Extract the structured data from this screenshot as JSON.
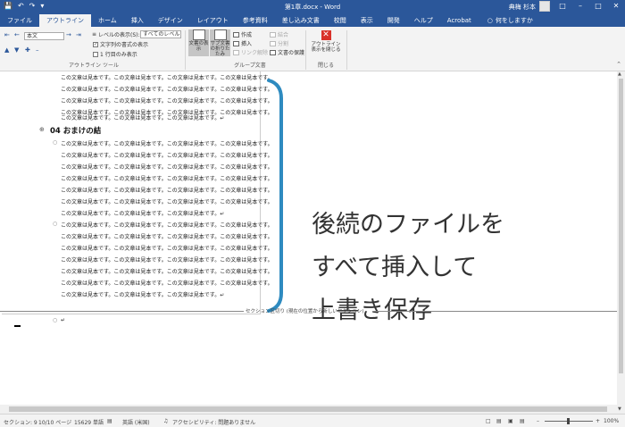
{
  "titlebar": {
    "doc_title": "第1章.docx - Word",
    "user_name": "典梅 杉本",
    "qat_icons": [
      "save-icon",
      "undo-icon",
      "redo-icon",
      "customize-icon"
    ],
    "window_buttons": [
      "ribbon-display-icon",
      "minimize-icon",
      "maximize-icon",
      "close-icon"
    ]
  },
  "tabs": {
    "items": [
      "ファイル",
      "アウトライン",
      "ホーム",
      "挿入",
      "デザイン",
      "レイアウト",
      "参考資料",
      "差し込み文書",
      "校閲",
      "表示",
      "開発",
      "ヘルプ",
      "Acrobat"
    ],
    "active_index": 1,
    "tell_me": "何をしますか"
  },
  "ribbon": {
    "outline_tools": {
      "level_value": "本文",
      "show_level_label": "レベルの表示(S):",
      "show_level_value": "すべてのレベル",
      "show_formatting": "文字列の書式の表示",
      "first_line_only": "1 行目のみ表示",
      "group_label": "アウトライン ツール"
    },
    "master_document": {
      "show_document": "文書の表示",
      "collapse_subdocs": "サブ文書の折りたたみ",
      "create": "作成",
      "insert": "挿入",
      "unlink": "リンク解除",
      "merge": "結合",
      "split": "分割",
      "lock_document": "文書の保護",
      "group_label": "グループ文書"
    },
    "close": {
      "close_outline": "アウトライン表示を閉じる",
      "group_label": "閉じる"
    }
  },
  "document": {
    "body_line": "この文章は見本です。この文章は見本です。この文章は見本です。この文章は見本です。",
    "body_line_last": "この文章は見本です。この文章は見本です。この文章は見本です。↵",
    "heading": "04 おまけの結",
    "section_break": "セクション区切り (現在の位置から新しいセクション)",
    "empty_para": "↵",
    "callout": [
      "後続のファイルを",
      "すべて挿入して",
      "上書き保存"
    ]
  },
  "statusbar": {
    "section": "セクション: 9",
    "pages": "10/10 ページ",
    "words": "15629 単語",
    "language": "英語 (米国)",
    "accessibility": "アクセシビリティ: 問題ありません",
    "zoom": "100%"
  },
  "colors": {
    "accent": "#2b579a",
    "callout_bracket": "#2e8bc0",
    "close_red": "#d9322a"
  }
}
